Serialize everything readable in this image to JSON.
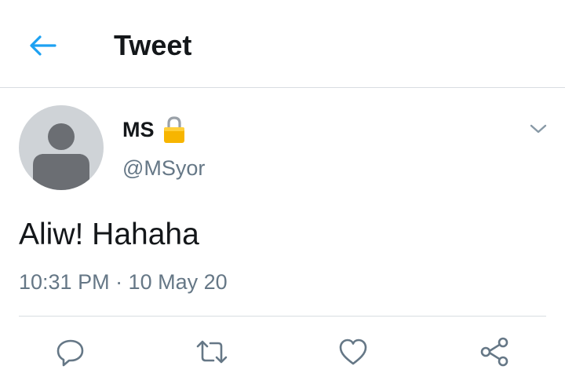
{
  "header": {
    "back_icon": "back-arrow-icon",
    "title": "Tweet"
  },
  "tweet": {
    "display_name": "MS",
    "protected_icon": "lock-icon",
    "handle": "@MSyor",
    "text": "Aliw! Hahaha",
    "timestamp": "10:31 PM · 10 May 20",
    "menu_icon": "chevron-down-icon"
  },
  "actions": [
    {
      "name": "reply",
      "icon": "reply-icon"
    },
    {
      "name": "retweet",
      "icon": "retweet-icon"
    },
    {
      "name": "like",
      "icon": "heart-icon"
    },
    {
      "name": "share",
      "icon": "share-icon"
    }
  ],
  "colors": {
    "accent": "#1da1f2",
    "text_primary": "#14171a",
    "text_secondary": "#657786",
    "divider": "#d8dde2",
    "lock": "#f7b500"
  }
}
